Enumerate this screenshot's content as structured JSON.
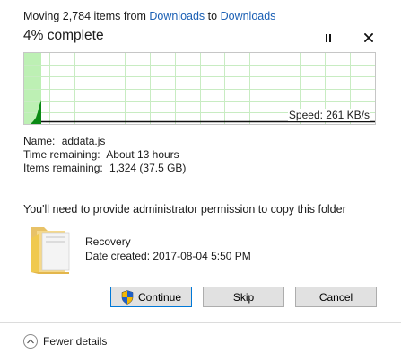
{
  "header": {
    "prefix": "Moving 2,784 items from",
    "source": "Downloads",
    "connector": "to",
    "destination": "Downloads"
  },
  "progress": {
    "label": "4% complete",
    "percent": 4,
    "speed": "Speed: 261 KB/s"
  },
  "details": {
    "name_label": "Name:",
    "name_value": "addata.js",
    "time_label": "Time remaining:",
    "time_value": "About 13 hours",
    "items_label": "Items remaining:",
    "items_value": "1,324 (37.5 GB)"
  },
  "permission": {
    "message": "You'll need to provide administrator permission to copy this folder",
    "folder_name": "Recovery",
    "date_created": "Date created: 2017-08-04 5:50 PM"
  },
  "buttons": {
    "continue": "Continue",
    "skip": "Skip",
    "cancel": "Cancel"
  },
  "footer": {
    "fewer_details": "Fewer details"
  },
  "colors": {
    "link": "#1a5fb4",
    "progress_fill": "#bdf0b4",
    "speed_curve": "#0a8a14",
    "grid": "#c8ecc2"
  },
  "icons": {
    "pause": "pause-icon",
    "close": "close-icon",
    "shield": "uac-shield-icon",
    "folder": "folder-icon",
    "chevron": "chevron-up-icon"
  }
}
